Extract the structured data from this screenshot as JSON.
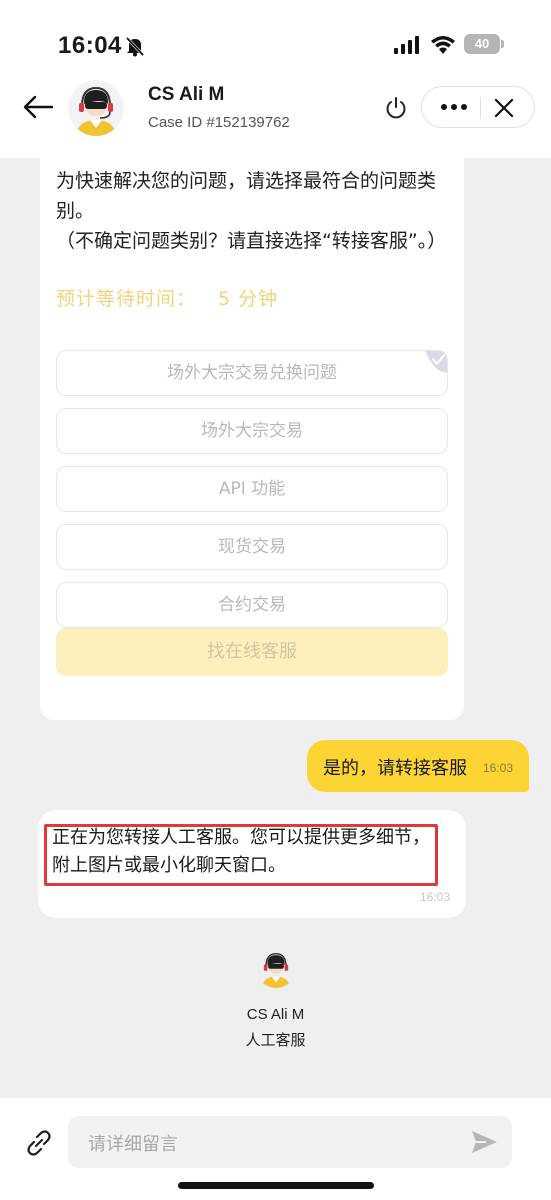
{
  "status_bar": {
    "time": "16:04",
    "battery": "40"
  },
  "header": {
    "agent_name": "CS Ali M",
    "case_id": "Case ID #152139762"
  },
  "bot_card": {
    "intro_line1": "为快速解决您的问题，请选择最符合的问题类别。",
    "intro_line2": "（不确定问题类别？请直接选择“转接客服”。）",
    "wait_label": "预计等待时间：",
    "wait_value": "5 分钟",
    "options": [
      "场外大宗交易兑换问题",
      "场外大宗交易",
      "API 功能",
      "现货交易",
      "合约交易"
    ],
    "find_agent": "找在线客服"
  },
  "user_message": {
    "text": "是的，请转接客服",
    "time": "16:03"
  },
  "bot_message": {
    "text": "正在为您转接人工客服。您可以提供更多细节，附上图片或最小化聊天窗口。",
    "time": "16:03"
  },
  "agent_join": {
    "name": "CS Ali M",
    "role": "人工客服"
  },
  "composer": {
    "placeholder": "请详细留言"
  },
  "colors": {
    "accent": "#fcd535",
    "highlight": "#dd3b3b",
    "chat_bg": "#efefef"
  },
  "icons": [
    "bell-off-icon",
    "signal-icon",
    "wifi-icon",
    "back-arrow-icon",
    "power-icon",
    "more-icon",
    "close-icon",
    "checkmark-icon",
    "paperclip-icon",
    "send-icon"
  ]
}
